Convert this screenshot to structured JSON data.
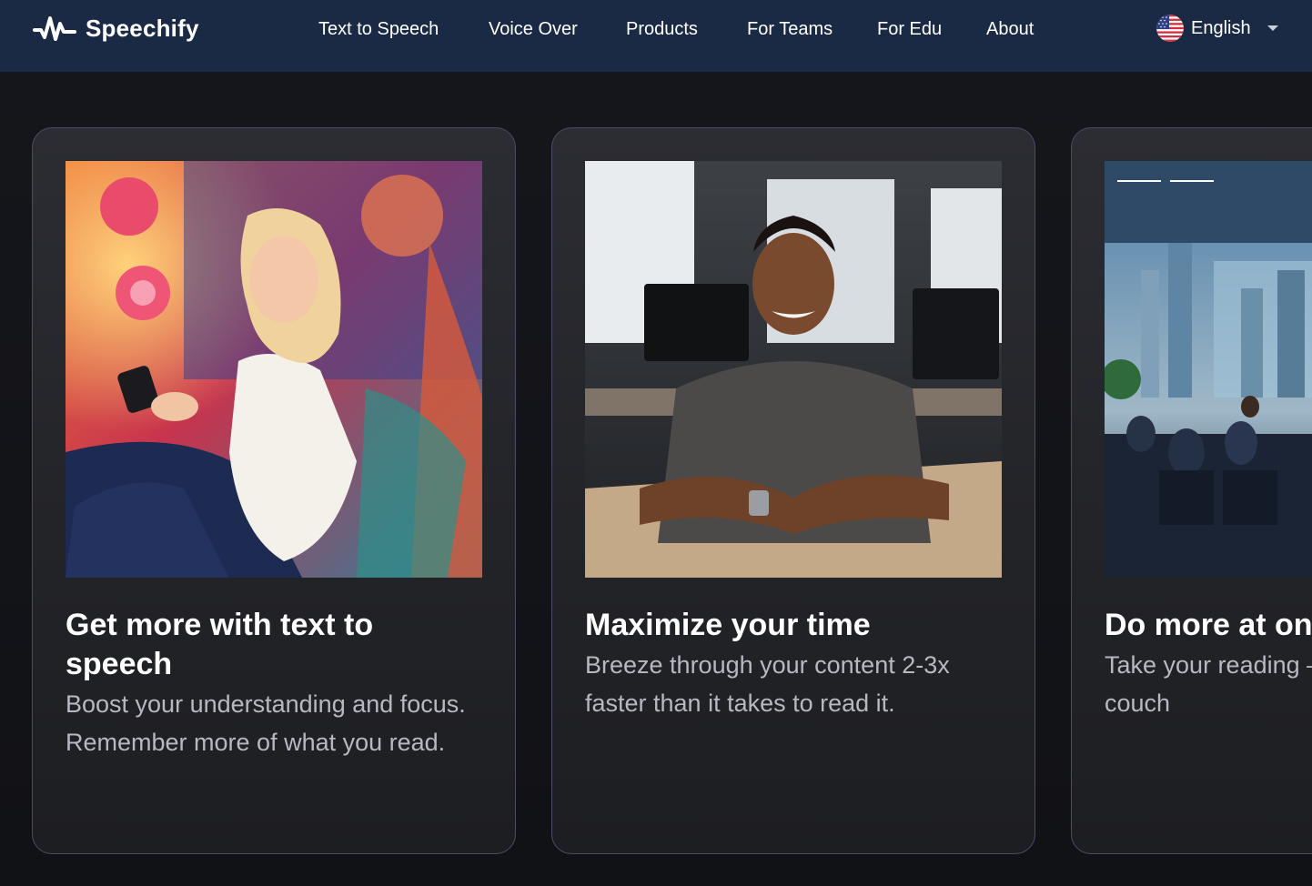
{
  "brand": {
    "name": "Speechify"
  },
  "nav": {
    "links": [
      "Text to Speech",
      "Voice Over",
      "Products",
      "For Teams",
      "For Edu",
      "About"
    ],
    "language": "English"
  },
  "cards": [
    {
      "title": "Get more with text to speech",
      "body": "Boost your understanding and focus. Remember more of what you read.",
      "image": "woman reading phone on colorful couch"
    },
    {
      "title": "Maximize your time",
      "body": "Breeze through your content 2-3x faster than it takes to read it.",
      "image": "smiling man in office"
    },
    {
      "title": "Do more at one",
      "body": "Take your reading – to the gym, the couch",
      "image": "people in meeting room with city view"
    }
  ],
  "icons": [
    "speechify-logo-icon",
    "us-flag-icon",
    "chevron-down-icon"
  ]
}
